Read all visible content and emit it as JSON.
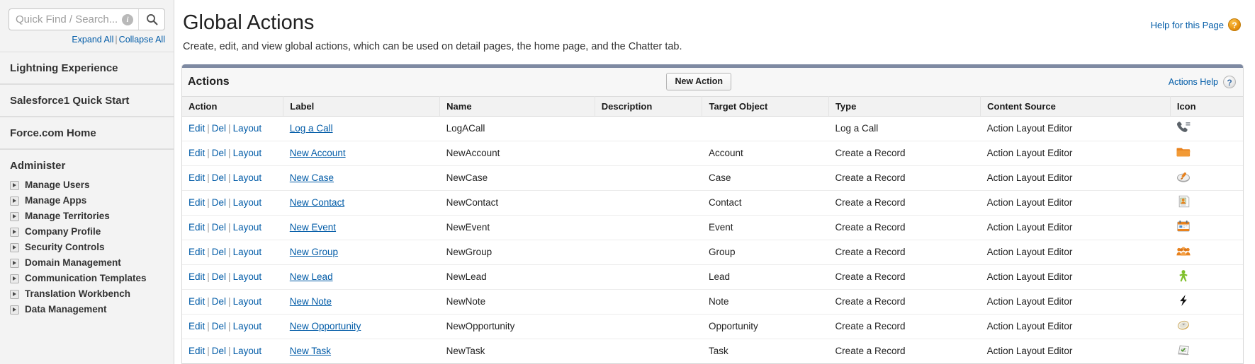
{
  "sidebar": {
    "search": {
      "placeholder": "Quick Find / Search...",
      "info_icon": "info-icon",
      "search_icon": "search-icon",
      "value": ""
    },
    "expand_all": "Expand All",
    "collapse_all": "Collapse All",
    "separator": "|",
    "sections": [
      {
        "label": "Lightning Experience"
      },
      {
        "label": "Salesforce1 Quick Start"
      },
      {
        "label": "Force.com Home"
      }
    ],
    "administer_label": "Administer",
    "items": [
      {
        "label": "Manage Users"
      },
      {
        "label": "Manage Apps"
      },
      {
        "label": "Manage Territories"
      },
      {
        "label": "Company Profile"
      },
      {
        "label": "Security Controls"
      },
      {
        "label": "Domain Management"
      },
      {
        "label": "Communication Templates"
      },
      {
        "label": "Translation Workbench"
      },
      {
        "label": "Data Management"
      }
    ]
  },
  "header": {
    "title": "Global Actions",
    "description": "Create, edit, and view global actions, which can be used on detail pages, the home page, and the Chatter tab.",
    "help_link": "Help for this Page",
    "help_icon_glyph": "?"
  },
  "panel": {
    "title": "Actions",
    "new_action_button": "New Action",
    "actions_help": "Actions Help",
    "help_icon_glyph": "?",
    "columns": [
      "Action",
      "Label",
      "Name",
      "Description",
      "Target Object",
      "Type",
      "Content Source",
      "Icon"
    ],
    "row_links": {
      "edit": "Edit",
      "del": "Del",
      "layout": "Layout"
    },
    "rows": [
      {
        "label": "Log a Call",
        "name": "LogACall",
        "description": "",
        "target": "",
        "type": "Log a Call",
        "source": "Action Layout Editor",
        "icon": "phone-log-icon"
      },
      {
        "label": "New Account",
        "name": "NewAccount",
        "description": "",
        "target": "Account",
        "type": "Create a Record",
        "source": "Action Layout Editor",
        "icon": "account-folder-icon"
      },
      {
        "label": "New Case",
        "name": "NewCase",
        "description": "",
        "target": "Case",
        "type": "Create a Record",
        "source": "Action Layout Editor",
        "icon": "case-briefcase-icon"
      },
      {
        "label": "New Contact",
        "name": "NewContact",
        "description": "",
        "target": "Contact",
        "type": "Create a Record",
        "source": "Action Layout Editor",
        "icon": "contact-card-icon"
      },
      {
        "label": "New Event",
        "name": "NewEvent",
        "description": "",
        "target": "Event",
        "type": "Create a Record",
        "source": "Action Layout Editor",
        "icon": "calendar-event-icon"
      },
      {
        "label": "New Group",
        "name": "NewGroup",
        "description": "",
        "target": "Group",
        "type": "Create a Record",
        "source": "Action Layout Editor",
        "icon": "group-people-icon"
      },
      {
        "label": "New Lead",
        "name": "NewLead",
        "description": "",
        "target": "Lead",
        "type": "Create a Record",
        "source": "Action Layout Editor",
        "icon": "lead-person-icon"
      },
      {
        "label": "New Note",
        "name": "NewNote",
        "description": "",
        "target": "Note",
        "type": "Create a Record",
        "source": "Action Layout Editor",
        "icon": "note-bolt-icon"
      },
      {
        "label": "New Opportunity",
        "name": "NewOpportunity",
        "description": "",
        "target": "Opportunity",
        "type": "Create a Record",
        "source": "Action Layout Editor",
        "icon": "opportunity-coin-icon"
      },
      {
        "label": "New Task",
        "name": "NewTask",
        "description": "",
        "target": "Task",
        "type": "Create a Record",
        "source": "Action Layout Editor",
        "icon": "task-checklist-icon"
      }
    ]
  },
  "colors": {
    "link": "#015ba7",
    "panel_bar": "#7e8aa2",
    "sidebar_bg": "#f3f3f3",
    "help_orb_orange": "#e8920f"
  }
}
